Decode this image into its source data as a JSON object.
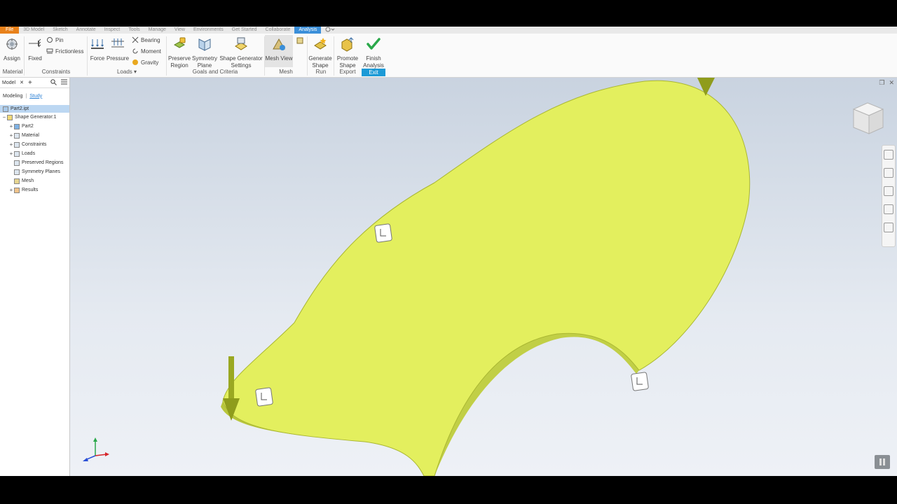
{
  "menu_tabs": [
    "File",
    "3D Model",
    "Sketch",
    "Annotate",
    "Inspect",
    "Tools",
    "Manage",
    "View",
    "Environments",
    "Get Started",
    "Collaborate",
    "Analysis"
  ],
  "ribbon": {
    "assign": "Assign",
    "fixed": "Fixed",
    "pin": "Pin",
    "frictionless": "Frictionless",
    "force": "Force",
    "pressure": "Pressure",
    "bearing": "Bearing",
    "moment": "Moment",
    "gravity": "Gravity",
    "preserve_region": [
      "Preserve",
      "Region"
    ],
    "symmetry_plane": [
      "Symmetry",
      "Plane"
    ],
    "shape_generator_settings": [
      "Shape Generator",
      "Settings"
    ],
    "mesh_view": "Mesh View",
    "generate_shape": [
      "Generate",
      "Shape"
    ],
    "promote_shape": [
      "Promote",
      "Shape"
    ],
    "finish_analysis": [
      "Finish",
      "Analysis"
    ],
    "panels": {
      "material": "Material",
      "constraints": "Constraints",
      "loads": "Loads ▾",
      "goals": "Goals and Criteria",
      "mesh": "Mesh",
      "run": "Run",
      "export": "Export",
      "exit": "Exit"
    }
  },
  "browser": {
    "title": "Model",
    "tabs": {
      "modeling": "Modeling",
      "separator": "|",
      "study": "Study"
    },
    "root": "Part2.ipt",
    "study_node": "Shape Generator:1",
    "items": [
      "Part2",
      "Material",
      "Constraints",
      "Loads",
      "Preserved Regions",
      "Symmetry Planes",
      "Mesh",
      "Results"
    ]
  },
  "colors": {
    "accent": "#3b8fd9",
    "file_tab": "#e8811a",
    "part": "#e3ef5e",
    "exit": "#1c9ad6"
  }
}
